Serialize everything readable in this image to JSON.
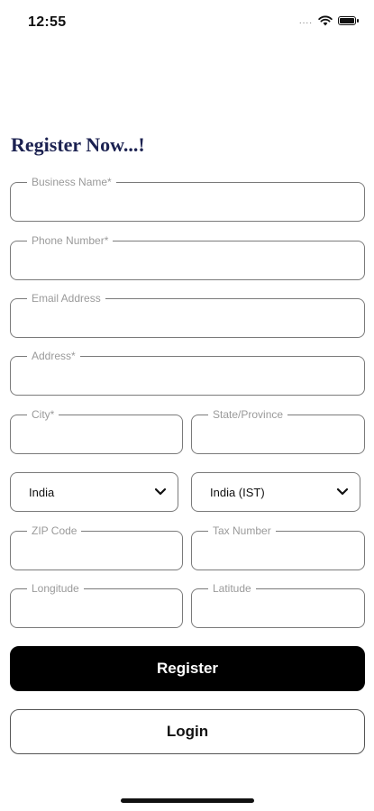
{
  "status_bar": {
    "time": "12:55",
    "signal": "....",
    "icons": [
      "wifi-icon",
      "battery-icon"
    ]
  },
  "title": "Register Now...!",
  "form": {
    "business_name": {
      "label": "Business Name*",
      "value": ""
    },
    "phone_number": {
      "label": "Phone Number*",
      "value": ""
    },
    "email_address": {
      "label": "Email Address",
      "value": ""
    },
    "address": {
      "label": "Address*",
      "value": ""
    },
    "city": {
      "label": "City*",
      "value": ""
    },
    "state_province": {
      "label": "State/Province",
      "value": ""
    },
    "country_select": {
      "value": "India"
    },
    "timezone_select": {
      "value": "India (IST)"
    },
    "zip_code": {
      "label": "ZIP Code",
      "value": ""
    },
    "tax_number": {
      "label": "Tax Number",
      "value": ""
    },
    "longitude": {
      "label": "Longitude",
      "value": ""
    },
    "latitude": {
      "label": "Latitude",
      "value": ""
    }
  },
  "buttons": {
    "register": "Register",
    "login": "Login"
  },
  "colors": {
    "title": "#1c2251",
    "primary_button": "#000000",
    "border": "#7a7a7a",
    "label": "#9a9a9a"
  }
}
